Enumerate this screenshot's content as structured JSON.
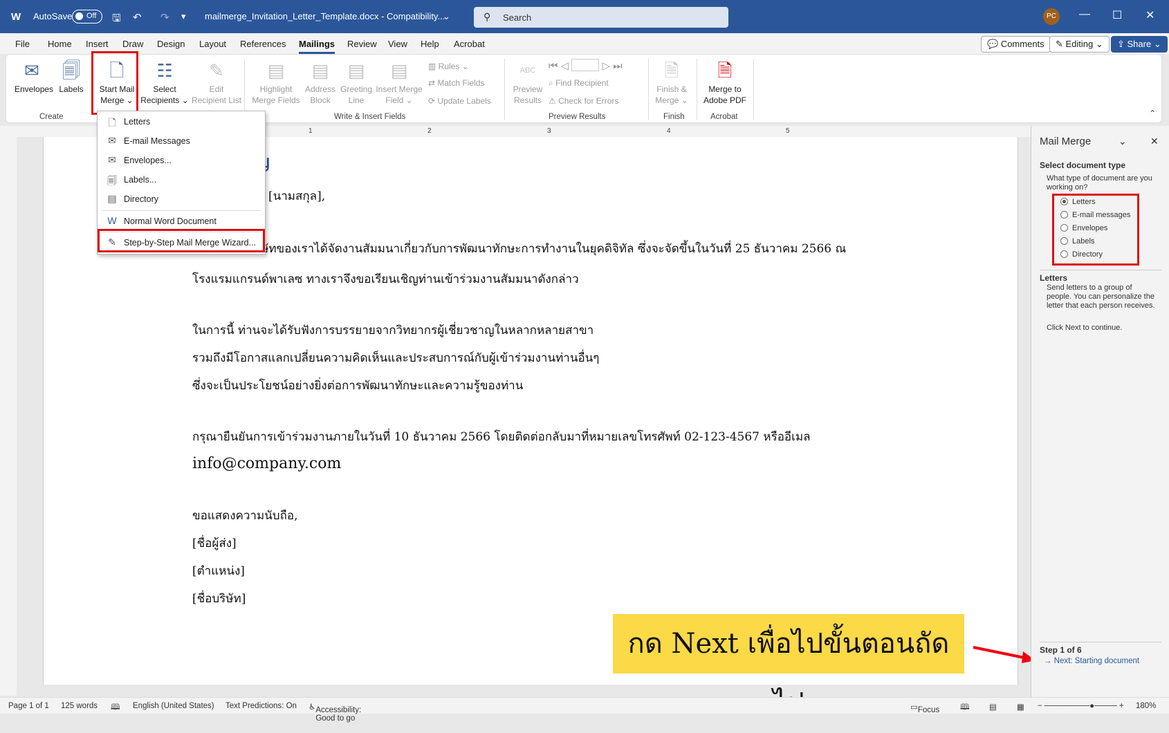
{
  "titlebar": {
    "autosave_label": "AutoSave",
    "autosave_state": "Off",
    "filename": "mailmerge_Invitation_Letter_Template.docx - Compatibility...",
    "search_placeholder": "Search",
    "user_initials": "PC"
  },
  "tabs": [
    "File",
    "Home",
    "Insert",
    "Draw",
    "Design",
    "Layout",
    "References",
    "Mailings",
    "Review",
    "View",
    "Help",
    "Acrobat"
  ],
  "active_tab": "Mailings",
  "right_buttons": {
    "comments": "Comments",
    "editing": "Editing",
    "share": "Share"
  },
  "ribbon": {
    "create": {
      "envelopes": "Envelopes",
      "labels": "Labels",
      "start_mail_merge_1": "Start Mail",
      "start_mail_merge_2": "Merge",
      "select_recipients_1": "Select",
      "select_recipients_2": "Recipients",
      "edit_list_1": "Edit",
      "edit_list_2": "Recipient List",
      "group": "Create"
    },
    "write": {
      "highlight_1": "Highlight",
      "highlight_2": "Merge Fields",
      "address_1": "Address",
      "address_2": "Block",
      "greeting_1": "Greeting",
      "greeting_2": "Line",
      "insert_1": "Insert Merge",
      "insert_2": "Field",
      "rules": "Rules",
      "match": "Match Fields",
      "update": "Update Labels",
      "group": "Write & Insert Fields"
    },
    "preview": {
      "preview_icon_text": "ABC",
      "preview_1": "Preview",
      "preview_2": "Results",
      "find": "Find Recipient",
      "check": "Check for Errors",
      "group": "Preview Results"
    },
    "finish": {
      "finish_1": "Finish &",
      "finish_2": "Merge",
      "group": "Finish"
    },
    "acrobat": {
      "merge_1": "Merge to",
      "merge_2": "Adobe PDF",
      "group": "Acrobat"
    }
  },
  "dropdown": [
    {
      "label": "Letters",
      "icon": "letter-icon"
    },
    {
      "label": "E-mail Messages",
      "icon": "email-icon"
    },
    {
      "label": "Envelopes...",
      "icon": "envelope-icon"
    },
    {
      "label": "Labels...",
      "icon": "label-icon"
    },
    {
      "label": "Directory",
      "icon": "directory-icon"
    },
    {
      "label": "Normal Word Document",
      "icon": "word-icon"
    },
    {
      "label": "Step-by-Step Mail Merge Wizard...",
      "icon": "wizard-icon"
    }
  ],
  "document": {
    "heading": "ชิญ",
    "line_name": "[นามสกุล],",
    "line1": "ริษัทของเราได้จัดงานสัมมนาเกี่ยวกับการพัฒนาทักษะการทำงานในยุคดิจิทัล ซึ่งจะจัดขึ้นในวันที่ 25 ธันวาคม 2566 ณ",
    "line2": "โรงแรมแกรนด์พาเลซ ทางเราจึงขอเรียนเชิญท่านเข้าร่วมงานสัมมนาดังกล่าว",
    "line3": "ในการนี้ ท่านจะได้รับฟังการบรรยายจากวิทยากรผู้เชี่ยวชาญในหลากหลายสาขา",
    "line4": "รวมถึงมีโอกาสแลกเปลี่ยนความคิดเห็นและประสบการณ์กับผู้เข้าร่วมงานท่านอื่นๆ",
    "line5": "ซึ่งจะเป็นประโยชน์อย่างยิ่งต่อการพัฒนาทักษะและความรู้ของท่าน",
    "line6": "กรุณายืนยันการเข้าร่วมงานภายในวันที่ 10 ธันวาคม 2566 โดยติดต่อกลับมาที่หมายเลขโทรศัพท์ 02-123-4567 หรืออีเมล",
    "line7": "info@company.com",
    "line8": "ขอแสดงความนับถือ,",
    "line9": "[ชื่อผู้ส่ง]",
    "line10": "[ตำแหน่ง]",
    "line11": "[ชื่อบริษัท]"
  },
  "callout": "กด Next เพื่อไปขั้นตอนถัดไป",
  "pane": {
    "title": "Mail Merge",
    "section": "Select document type",
    "question": "What type of document are you working on?",
    "options": [
      "Letters",
      "E-mail messages",
      "Envelopes",
      "Labels",
      "Directory"
    ],
    "selected": "Letters",
    "desc_title": "Letters",
    "desc": "Send letters to a group of people. You can personalize the letter that each person receives.",
    "hint": "Click Next to continue.",
    "step": "Step 1 of 6",
    "next": "Next: Starting document"
  },
  "ruler_numbers": [
    "1",
    "2",
    "3",
    "4",
    "5"
  ],
  "status": {
    "page": "Page 1 of 1",
    "words": "125 words",
    "language": "English (United States)",
    "predictions": "Text Predictions: On",
    "accessibility": "Accessibility: Good to go",
    "focus": "Focus",
    "zoom": "180%"
  },
  "colors": {
    "brand": "#2b579a",
    "highlight_box": "#dd1111",
    "callout_bg": "#fcd947"
  }
}
